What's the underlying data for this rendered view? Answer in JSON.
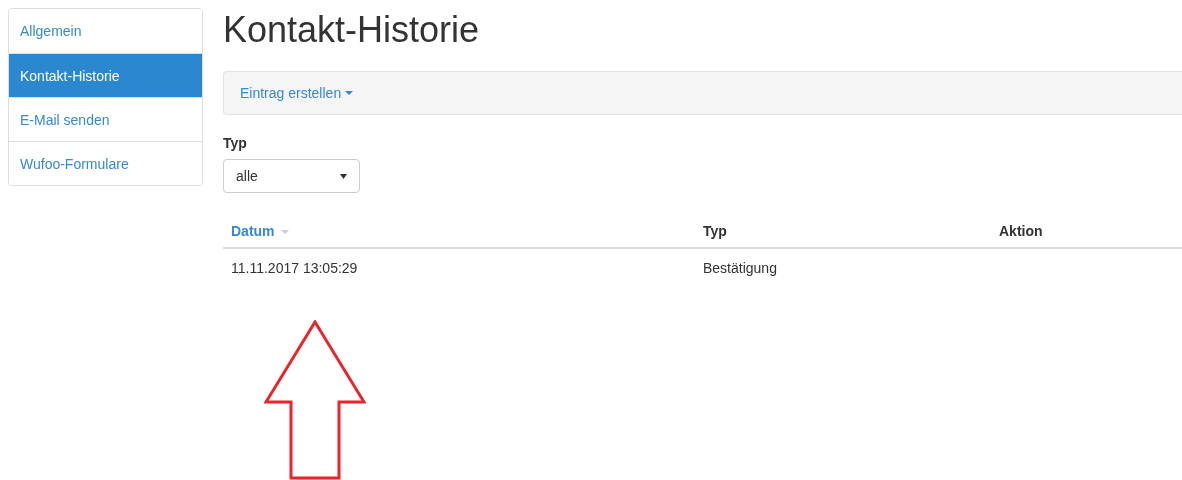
{
  "sidebar": {
    "items": [
      {
        "label": "Allgemein",
        "selected": false
      },
      {
        "label": "Kontakt-Historie",
        "selected": true
      },
      {
        "label": "E-Mail senden",
        "selected": false
      },
      {
        "label": "Wufoo-Formulare",
        "selected": false
      }
    ]
  },
  "title": "Kontakt-Historie",
  "toolbar": {
    "menu_button": "Eintrag erstellen"
  },
  "filter": {
    "label": "Typ",
    "value": "alle"
  },
  "table": {
    "columns": [
      {
        "label": "Datum",
        "sortable": true
      },
      {
        "label": "Typ",
        "sortable": false
      },
      {
        "label": "Aktion",
        "sortable": false
      }
    ],
    "rows": [
      {
        "cells": [
          "11.11.2017 13:05:29",
          "Bestätigung",
          ""
        ]
      }
    ]
  }
}
